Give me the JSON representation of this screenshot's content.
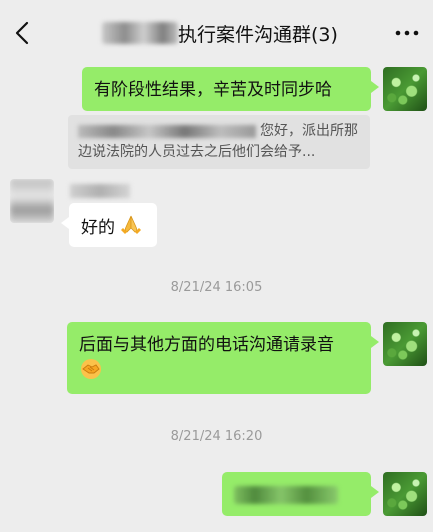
{
  "header": {
    "title": "执行案件沟通群(3)",
    "back_icon": "chevron-left-icon",
    "more_icon": "more-dots-icon"
  },
  "messages": [
    {
      "sender": "me",
      "text": "有阶段性结果，辛苦及时同步哈"
    },
    {
      "type": "quote",
      "text": "您好，派出所那边说法院的人员过去之后他们会给予..."
    },
    {
      "sender": "other",
      "text": "好的",
      "emoji": "folded-hands-emoji"
    },
    {
      "type": "timestamp",
      "text": "8/21/24 16:05"
    },
    {
      "sender": "me",
      "text": "后面与其他方面的电话沟通请录音",
      "emoji": "handshake-emoji"
    },
    {
      "type": "timestamp",
      "text": "8/21/24 16:20"
    },
    {
      "sender": "me",
      "redacted": true
    }
  ],
  "colors": {
    "my_bubble": "#95ec69",
    "other_bubble": "#ffffff",
    "background": "#ededed"
  }
}
